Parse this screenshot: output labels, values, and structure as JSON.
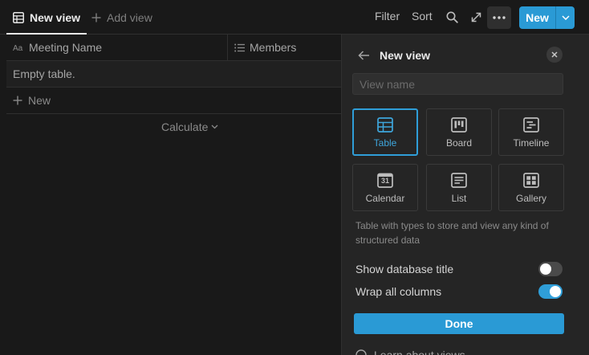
{
  "tabs": [
    {
      "label": "New view",
      "icon": "table-icon",
      "active": true
    },
    {
      "label": "Add view",
      "icon": "plus-icon",
      "active": false
    }
  ],
  "toolbar": {
    "filter_label": "Filter",
    "sort_label": "Sort",
    "new_label": "New",
    "accent_color": "#2a9ad5"
  },
  "table": {
    "columns": [
      {
        "label": "Meeting Name",
        "icon": "text-property-icon"
      },
      {
        "label": "Members",
        "icon": "list-icon"
      }
    ],
    "empty_text": "Empty table.",
    "new_row_label": "New",
    "calculate_label": "Calculate"
  },
  "panel": {
    "title": "New view",
    "view_name_placeholder": "View name",
    "view_name_value": "",
    "view_types": [
      {
        "label": "Table",
        "icon": "table-icon",
        "selected": true
      },
      {
        "label": "Board",
        "icon": "board-icon",
        "selected": false
      },
      {
        "label": "Timeline",
        "icon": "timeline-icon",
        "selected": false
      },
      {
        "label": "Calendar",
        "icon": "calendar-icon",
        "selected": false,
        "day": "31"
      },
      {
        "label": "List",
        "icon": "list-view-icon",
        "selected": false
      },
      {
        "label": "Gallery",
        "icon": "gallery-icon",
        "selected": false
      }
    ],
    "description": "Table with types to store and view any kind of structured data",
    "settings": [
      {
        "label": "Show database title",
        "enabled": false
      },
      {
        "label": "Wrap all columns",
        "enabled": true
      }
    ],
    "done_label": "Done",
    "learn_label": "Learn about views"
  }
}
